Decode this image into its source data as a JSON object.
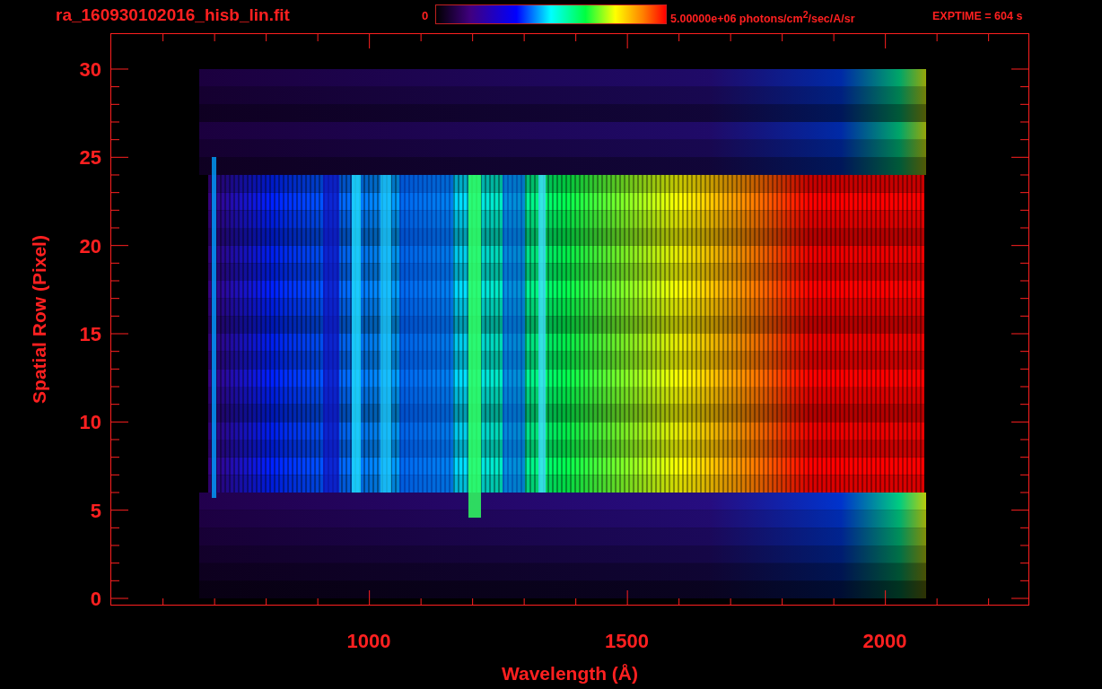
{
  "header": {
    "title": "ra_160930102016_hisb_lin.fit",
    "colorbar_min": "0",
    "colorbar_max": "5.00000e+06 photons/cm$^{2}$/sec/A/sr",
    "exptime": "EXPTIME = 604 s"
  },
  "plot": {
    "xlabel": "Wavelength (Å)",
    "ylabel": "Spatial Row (Pixel)",
    "xtick_labels": [
      "1000",
      "1500",
      "2000"
    ],
    "ytick_labels": [
      "30",
      "25",
      "20",
      "15",
      "10",
      "5",
      "0"
    ]
  }
}
